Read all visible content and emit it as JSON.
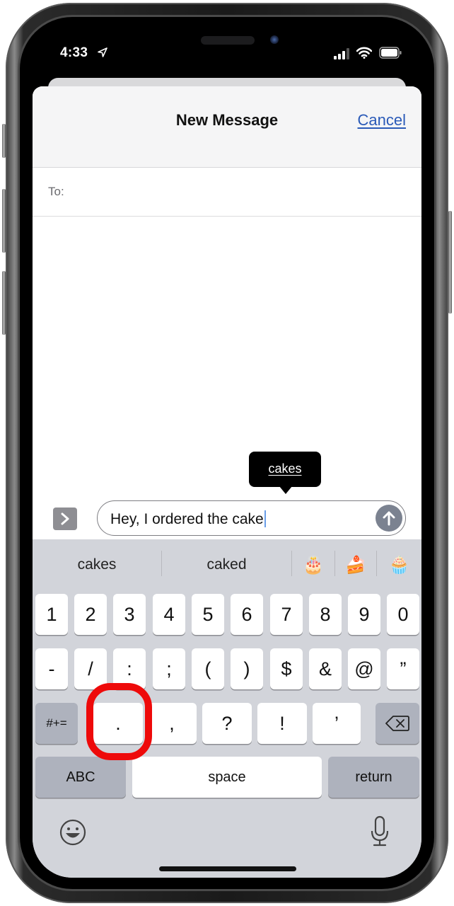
{
  "status_bar": {
    "time": "4:33",
    "icons": [
      "location-arrow-icon",
      "cellular-signal-icon",
      "wifi-icon",
      "battery-icon"
    ]
  },
  "nav": {
    "title": "New Message",
    "cancel_label": "Cancel",
    "accent_color": "#2a5ab8"
  },
  "recipient": {
    "label": "To:",
    "value": ""
  },
  "autocorrect_tooltip": {
    "suggestion": "cakes"
  },
  "compose": {
    "apps_icon": "chevron-right-icon",
    "text": "Hey, I ordered the cake",
    "send_icon": "arrow-up-icon"
  },
  "keyboard": {
    "predictions": [
      {
        "label": "cakes",
        "type": "word"
      },
      {
        "label": "caked",
        "type": "word"
      },
      {
        "label": "🎂",
        "type": "emoji",
        "name": "birthday-cake-emoji"
      },
      {
        "label": "🍰",
        "type": "emoji",
        "name": "shortcake-emoji"
      },
      {
        "label": "🧁",
        "type": "emoji",
        "name": "cupcake-emoji"
      }
    ],
    "row1": [
      "1",
      "2",
      "3",
      "4",
      "5",
      "6",
      "7",
      "8",
      "9",
      "0"
    ],
    "row2": [
      "-",
      "/",
      ":",
      ";",
      "(",
      ")",
      "$",
      "&",
      "@",
      "”"
    ],
    "row3": {
      "shift_label": "#+=",
      "keys": [
        ".",
        ",",
        "?",
        "!",
        "’"
      ],
      "delete_icon": "backspace-icon"
    },
    "row4": {
      "abc_label": "ABC",
      "space_label": "space",
      "return_label": "return"
    },
    "bottom": {
      "emoji_icon": "emoji-smiley-icon",
      "dictation_icon": "microphone-icon"
    },
    "highlighted_key": ".",
    "highlight_color": "#ee0a0a"
  }
}
